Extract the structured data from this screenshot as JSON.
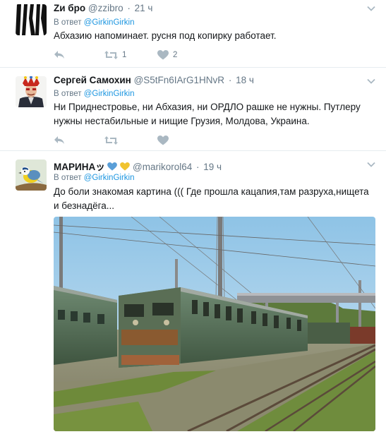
{
  "tweets": [
    {
      "fullname": "Zи бро",
      "username": "@zzibro",
      "time": "21 ч",
      "reply_prefix": "В ответ",
      "reply_to": "@GirkinGirkin",
      "text": "Абхазию напоминает. русня под копирку работает.",
      "retweets": "1",
      "likes": "2"
    },
    {
      "fullname": "Сергей Самохин",
      "username": "@S5tFn6IArG1HNvR",
      "time": "18 ч",
      "reply_prefix": "В ответ",
      "reply_to": "@GirkinGirkin",
      "text": "Ни Приднестровье, ни Абхазия, ни ОРДЛО рашке не нужны. Путлеру нужны нестабильные и нищие Грузия, Молдова, Украина."
    },
    {
      "fullname": "МАРИНА",
      "name_symbols": "ッ",
      "username": "@marikorol64",
      "time": "19 ч",
      "reply_prefix": "В ответ",
      "reply_to": "@GirkinGirkin",
      "text": "До боли знакомая картина ((( Где прошла кацапия,там разруха,нищета и безнадёга..."
    }
  ],
  "colors": {
    "link": "#1b95e0",
    "secondary_text": "#657786",
    "icon": "#aab8c2"
  },
  "icons": {
    "reply": "reply-icon",
    "retweet": "retweet-icon",
    "like": "heart-icon",
    "more": "chevron-down-icon"
  }
}
